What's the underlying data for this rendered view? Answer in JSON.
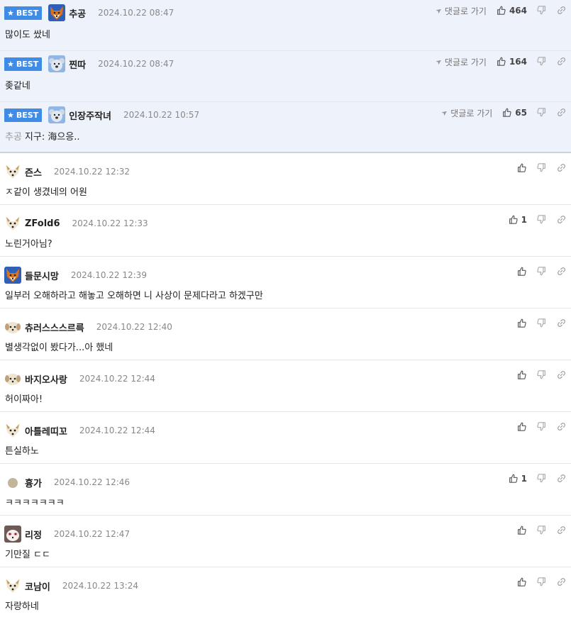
{
  "best_badge": "BEST",
  "reply_label": "댓글로 가기",
  "comments": [
    {
      "best": true,
      "avatar": "fox-avatar",
      "nick": "추공",
      "date": "2024.10.22 08:47",
      "quote": "",
      "text": "많이도 쌌네",
      "likes": "464"
    },
    {
      "best": true,
      "avatar": "koala-avatar",
      "nick": "찐따",
      "date": "2024.10.22 08:47",
      "quote": "",
      "text": "좆같네",
      "likes": "164"
    },
    {
      "best": true,
      "avatar": "koala-avatar",
      "nick": "인장주작녀",
      "date": "2024.10.22 10:57",
      "quote": "추공",
      "text": "지구: 海으응..",
      "likes": "65"
    },
    {
      "best": false,
      "avatar": "dog-avatar",
      "nick": "즌스",
      "date": "2024.10.22 12:32",
      "quote": "",
      "text": "ㅈ같이 생겼네의 어원",
      "likes": ""
    },
    {
      "best": false,
      "avatar": "dog-avatar",
      "nick": "ZFold6",
      "date": "2024.10.22 12:33",
      "quote": "",
      "text": "노린거아님?",
      "likes": "1"
    },
    {
      "best": false,
      "avatar": "fox-avatar",
      "nick": "들문시망",
      "date": "2024.10.22 12:39",
      "quote": "",
      "text": "일부러 오해하라고 해놓고 오해하면 니 사상이 문제다라고 하겠구만",
      "likes": ""
    },
    {
      "best": false,
      "avatar": "puppy-avatar",
      "nick": "츄러스스스르륵",
      "date": "2024.10.22 12:40",
      "quote": "",
      "text": "별생각없이 봤다가...아 했네",
      "likes": ""
    },
    {
      "best": false,
      "avatar": "puppy-avatar",
      "nick": "바지오사랑",
      "date": "2024.10.22 12:44",
      "quote": "",
      "text": "허이짜아!",
      "likes": ""
    },
    {
      "best": false,
      "avatar": "dog-avatar",
      "nick": "아틀레띠꼬",
      "date": "2024.10.22 12:44",
      "quote": "",
      "text": "튼실하노",
      "likes": ""
    },
    {
      "best": false,
      "avatar": "circle-avatar",
      "nick": "흉가",
      "date": "2024.10.22 12:46",
      "quote": "",
      "text": "ㅋㅋㅋㅋㅋㅋㅋ",
      "likes": "1"
    },
    {
      "best": false,
      "avatar": "panda-avatar",
      "nick": "리정",
      "date": "2024.10.22 12:47",
      "quote": "",
      "text": "기만질 ㄷㄷ",
      "likes": ""
    },
    {
      "best": false,
      "avatar": "dog-avatar",
      "nick": "코남이",
      "date": "2024.10.22 13:24",
      "quote": "",
      "text": "자랑하네",
      "likes": ""
    }
  ],
  "colors": {
    "badge": "#3e8ce6",
    "best_bg": "#eef3fb",
    "border": "#e6e6e6"
  }
}
